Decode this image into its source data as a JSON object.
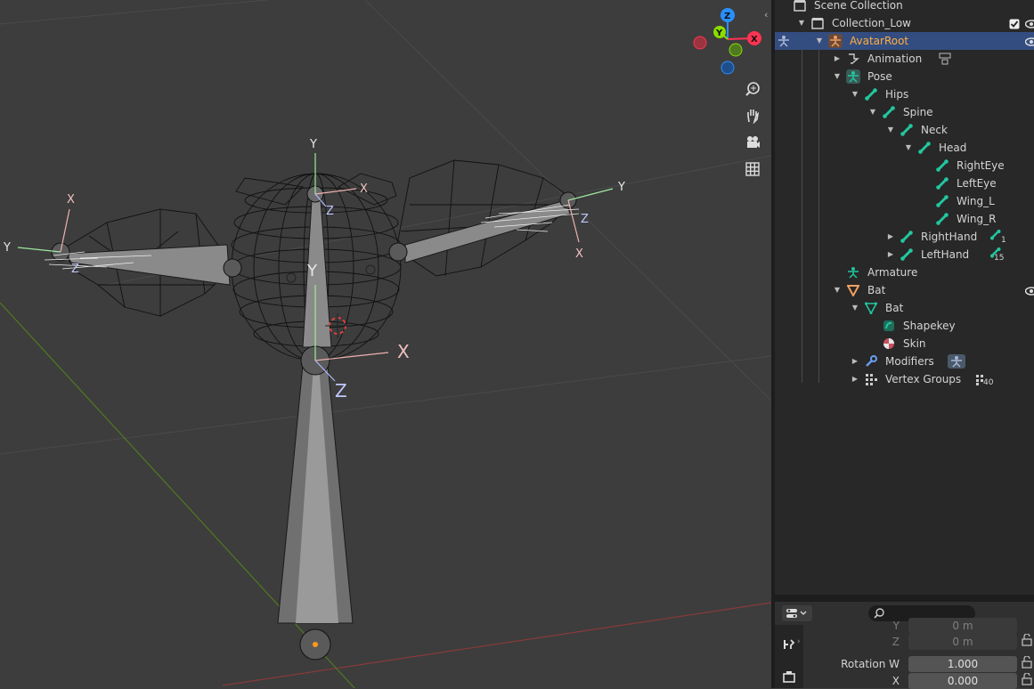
{
  "viewport": {
    "gizmo": {
      "z": "Z",
      "y": "Y",
      "x": "X"
    },
    "axes": {
      "head_y": "Y",
      "head_x": "X",
      "head_z": "Z",
      "hips_y": "Y",
      "hips_x": "X",
      "hips_z": "Z",
      "left_y": "Y",
      "left_x": "X",
      "left_z": "Z",
      "right_y": "Y",
      "right_x": "X",
      "right_z": "Z"
    },
    "nav_icons": [
      "zoom-icon",
      "hand-icon",
      "camera-icon",
      "grid-icon"
    ]
  },
  "outliner": {
    "rows": [
      {
        "label": "Scene Collection"
      },
      {
        "label": "Collection_Low"
      },
      {
        "label": "AvatarRoot"
      },
      {
        "label": "Animation"
      },
      {
        "label": "Pose"
      },
      {
        "label": "Hips"
      },
      {
        "label": "Spine"
      },
      {
        "label": "Neck"
      },
      {
        "label": "Head"
      },
      {
        "label": "RightEye"
      },
      {
        "label": "LeftEye"
      },
      {
        "label": "Wing_L"
      },
      {
        "label": "Wing_R"
      },
      {
        "label": "RightHand",
        "count": "1"
      },
      {
        "label": "LeftHand",
        "count": "15"
      },
      {
        "label": "Armature"
      },
      {
        "label": "Bat"
      },
      {
        "label": "Bat"
      },
      {
        "label": "Shapekey"
      },
      {
        "label": "Skin"
      },
      {
        "label": "Modifiers"
      },
      {
        "label": "Vertex Groups",
        "count": "40"
      }
    ]
  },
  "properties": {
    "search_placeholder": "",
    "fields": [
      {
        "label": "Y",
        "value": "0 m"
      },
      {
        "label": "Z",
        "value": "0 m"
      },
      {
        "label": "Rotation W",
        "value": "1.000"
      },
      {
        "label": "X",
        "value": "0.000"
      }
    ]
  },
  "colors": {
    "selected_row": "#334d80",
    "bone_green": "#21c7a0",
    "axis_x": "#ff3352",
    "axis_y": "#8bdc00",
    "axis_z": "#2890ff"
  }
}
